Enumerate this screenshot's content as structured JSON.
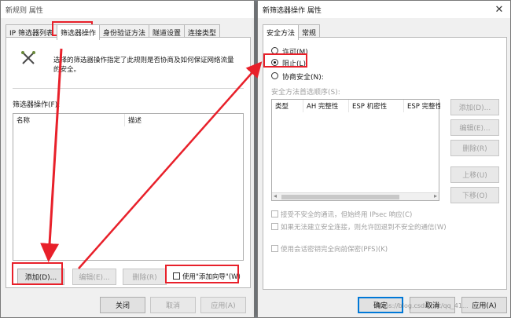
{
  "left_window": {
    "title": "新规则 属性",
    "tabs": [
      "IP 筛选器列表",
      "筛选器操作",
      "身份验证方法",
      "隧道设置",
      "连接类型"
    ],
    "description": "选择的筛选器操作指定了此规则是否协商及如何来保证网络流量的安全。",
    "description_line1": "选择的筛选器操作指定了此规则是否协商及如何保证网络流量",
    "description_line2": "的安全。",
    "section_label": "筛选器操作(F):",
    "columns": [
      "名称",
      "描述"
    ],
    "buttons": {
      "add": "添加(D)...",
      "edit": "编辑(E)...",
      "delete": "删除(R)",
      "wizard": "使用\"添加向导\"(W)"
    },
    "footer": {
      "close": "关闭",
      "cancel": "取消",
      "apply": "应用(A)"
    }
  },
  "right_window": {
    "title": "新筛选器操作 属性",
    "tabs": [
      "安全方法",
      "常规"
    ],
    "options": {
      "permit": "许可(M)",
      "block": "阻止(L)",
      "negotiate": "协商安全(N):"
    },
    "selected_option": "block",
    "methods_label": "安全方法首选顺序(S):",
    "columns": [
      "类型",
      "AH 完整性",
      "ESP 机密性",
      "ESP 完整性"
    ],
    "side_buttons": {
      "add": "添加(D)...",
      "edit": "编辑(E)...",
      "delete": "删除(R)",
      "up": "上移(U)",
      "down": "下移(O)"
    },
    "checkboxes": {
      "accept_unsecured": "接受不安全的通讯，但始终用 IPsec 响应(C)",
      "fallback": "如果无法建立安全连接，则允许回退到不安全的通信(W)",
      "pfs": "使用会话密钥完全向前保密(PFS)(K)"
    },
    "footer": {
      "ok": "确定",
      "cancel": "取消",
      "apply": "应用(A)"
    },
    "watermark": "https://blog.csdn.net/qq_41..."
  },
  "colors": {
    "annotation_red": "#e8202a",
    "focus_blue": "#0078d7"
  }
}
